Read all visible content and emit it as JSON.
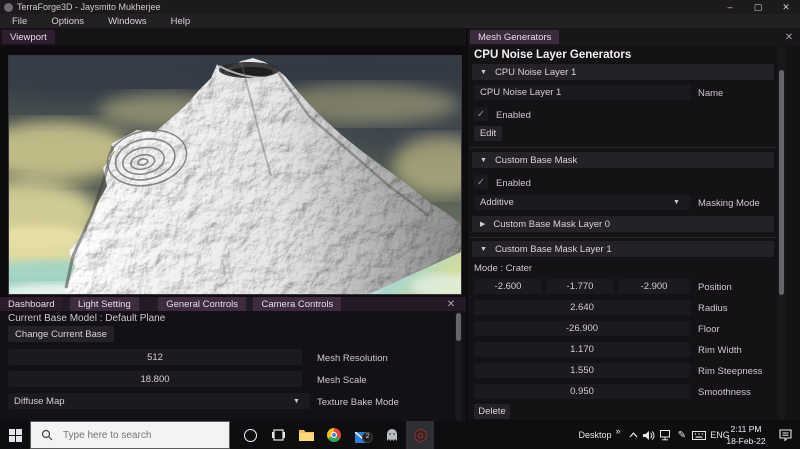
{
  "glyphs": {
    "collapse": "▼",
    "expand": "▶",
    "dropdown": "▼",
    "check": "✓",
    "close": "✕",
    "minimize": "–",
    "maximize": "▢",
    "overflow": "»",
    "chevron_up": "^",
    "pen": "✎"
  },
  "colors": {
    "accent_purple": "#3d2a3f",
    "panel_bg": "#141215",
    "field_bg": "#1c1a1e",
    "taskbar_bg": "#0e0e10"
  },
  "titlebar": {
    "title": "TerraForge3D - Jaysmito Mukherjee"
  },
  "menu": {
    "items": [
      "File",
      "Options",
      "Windows",
      "Help"
    ]
  },
  "viewport": {
    "tab": "Viewport"
  },
  "mesh_panel": {
    "tab": "Mesh Generators",
    "title": "CPU Noise Layer Generators",
    "noise_layer": {
      "header": "CPU Noise Layer 1",
      "name_value": "CPU Noise Layer 1",
      "name_label": "Name",
      "enabled_label": "Enabled",
      "edit_button": "Edit"
    },
    "base_mask": {
      "header": "Custom Base Mask",
      "enabled_label": "Enabled",
      "masking_mode_value": "Additive",
      "masking_mode_label": "Masking Mode",
      "layer0_header": "Custom Base Mask Layer 0",
      "layer1_header": "Custom Base Mask Layer 1",
      "mode_text": "Mode : Crater",
      "position": {
        "label": "Position",
        "x": "-2.600",
        "y": "-1.770",
        "z": "-2.900"
      },
      "radius": {
        "label": "Radius",
        "value": "2.640"
      },
      "floor": {
        "label": "Floor",
        "value": "-26.900"
      },
      "rim_width": {
        "label": "Rim Width",
        "value": "1.170"
      },
      "rim_steepness": {
        "label": "Rim Steepness",
        "value": "1.550"
      },
      "smoothness": {
        "label": "Smoothness",
        "value": "0.950"
      },
      "delete_button": "Delete"
    }
  },
  "dashboard_panel": {
    "tabs": [
      "Dashboard",
      "Light Setting",
      "General Controls",
      "Camera Controls"
    ],
    "current_base_text": "Current Base Model : Default Plane",
    "change_base_button": "Change Current Base",
    "mesh_resolution": {
      "value": "512",
      "label": "Mesh Resolution"
    },
    "mesh_scale": {
      "value": "18.800",
      "label": "Mesh Scale"
    },
    "texture_bake_mode": {
      "value": "Diffuse Map",
      "label": "Texture Bake Mode"
    }
  },
  "taskbar": {
    "search_placeholder": "Type here to search",
    "mail_badge": "2",
    "tray": {
      "desktop_label": "Desktop",
      "language": "ENG",
      "time": "2:11 PM",
      "date": "18-Feb-22"
    }
  }
}
